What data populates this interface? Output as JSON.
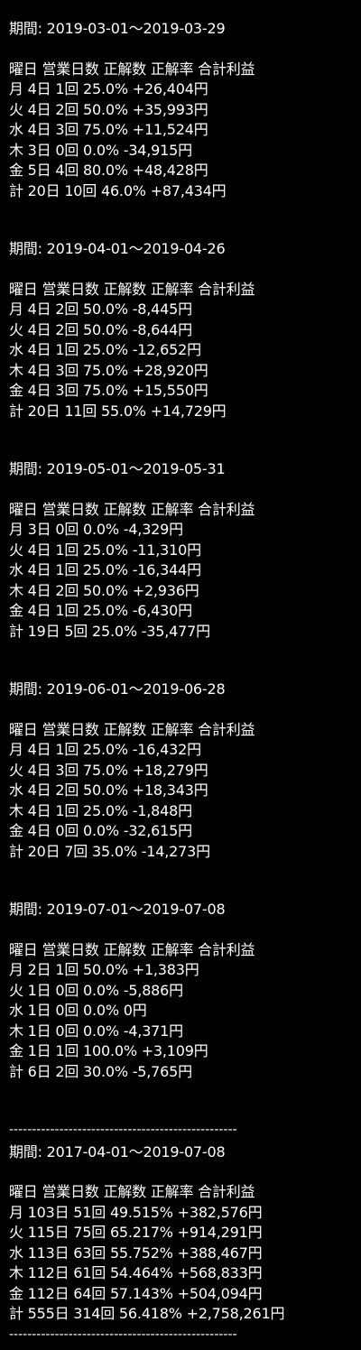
{
  "sections": [
    {
      "period": "期間: 2019-03-01〜2019-03-29",
      "header": "曜日 営業日数 正解数 正解率 合計利益",
      "rows": [
        "月 4日 1回 25.0% +26,404円",
        "火 4日 2回 50.0% +35,993円",
        "水 4日 3回 75.0% +11,524円",
        "木 3日 0回 0.0% -34,915円",
        "金 5日 4回 80.0% +48,428円",
        "計 20日 10回 46.0% +87,434円"
      ]
    },
    {
      "period": "期間: 2019-04-01〜2019-04-26",
      "header": "曜日 営業日数 正解数 正解率 合計利益",
      "rows": [
        "月 4日 2回 50.0% -8,445円",
        "火 4日 2回 50.0% -8,644円",
        "水 4日 1回 25.0% -12,652円",
        "木 4日 3回 75.0% +28,920円",
        "金 4日 3回 75.0% +15,550円",
        "計 20日 11回 55.0% +14,729円"
      ]
    },
    {
      "period": "期間: 2019-05-01〜2019-05-31",
      "header": "曜日 営業日数 正解数 正解率 合計利益",
      "rows": [
        "月 3日 0回 0.0% -4,329円",
        "火 4日 1回 25.0% -11,310円",
        "水 4日 1回 25.0% -16,344円",
        "木 4日 2回 50.0% +2,936円",
        "金 4日 1回 25.0% -6,430円",
        "計 19日 5回 25.0% -35,477円"
      ]
    },
    {
      "period": "期間: 2019-06-01〜2019-06-28",
      "header": "曜日 営業日数 正解数 正解率 合計利益",
      "rows": [
        "月 4日 1回 25.0% -16,432円",
        "火 4日 3回 75.0% +18,279円",
        "水 4日 2回 50.0% +18,343円",
        "木 4日 1回 25.0% -1,848円",
        "金 4日 0回 0.0% -32,615円",
        "計 20日 7回 35.0% -14,273円"
      ]
    },
    {
      "period": "期間: 2019-07-01〜2019-07-08",
      "header": "曜日 営業日数 正解数 正解率 合計利益",
      "rows": [
        "月 2日 1回 50.0% +1,383円",
        "火 1日 0回 0.0% -5,886円",
        "水 1日 0回 0.0% 0円",
        "木 1日 0回 0.0% -4,371円",
        "金 1日 1回 100.0% +3,109円",
        "計 6日 2回 30.0% -5,765円"
      ]
    }
  ],
  "divider": "--------------------------------------------------",
  "summary": {
    "period": "期間: 2017-04-01〜2019-07-08",
    "header": "曜日 営業日数 正解数 正解率 合計利益",
    "rows": [
      "月 103日 51回 49.515% +382,576円",
      "火 115日 75回 65.217% +914,291円",
      "水 113日 63回 55.752% +388,467円",
      "木 112日 61回 54.464% +568,833円",
      "金 112日 64回 57.143% +504,094円",
      "計 555日 314回 56.418% +2,758,261円"
    ]
  }
}
